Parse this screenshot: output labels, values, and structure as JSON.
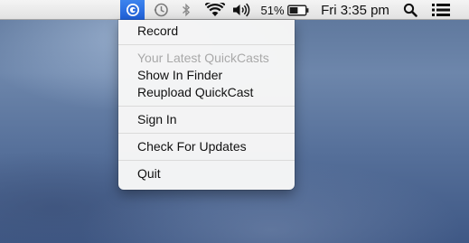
{
  "menubar": {
    "quickcast_icon": "quickcast-icon",
    "time_machine_icon": "time-machine-icon",
    "bluetooth_icon": "bluetooth-icon",
    "wifi_icon": "wifi-icon",
    "volume_icon": "volume-icon",
    "battery_percent": "51%",
    "battery_icon": "battery-icon",
    "clock": "Fri 3:35 pm",
    "spotlight_icon": "search-icon",
    "notification_icon": "notification-center-icon",
    "accent_color": "#2f6fde"
  },
  "menu": {
    "record": "Record",
    "latest_header": "Your Latest QuickCasts",
    "show_in_finder": "Show In Finder",
    "reupload": "Reupload QuickCast",
    "sign_in": "Sign In",
    "check_updates": "Check For Updates",
    "quit": "Quit"
  }
}
